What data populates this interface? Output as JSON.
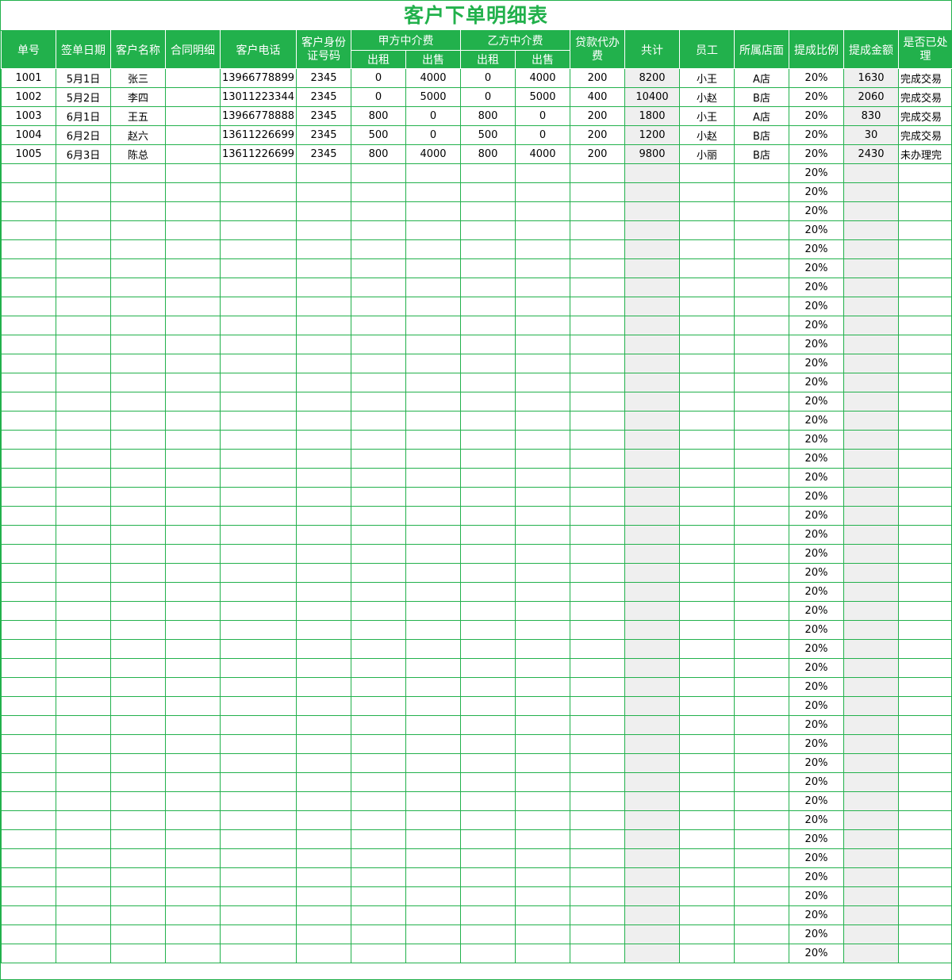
{
  "title": "客户下单明细表",
  "headers": {
    "order_no": "单号",
    "sign_date": "签单日期",
    "customer_name": "客户名称",
    "contract_detail": "合同明细",
    "customer_phone": "客户电话",
    "customer_id": "客户身份证号码",
    "party_a_fee": "甲方中介费",
    "party_b_fee": "乙方中介费",
    "rent": "出租",
    "sale": "出售",
    "loan_fee": "贷款代办费",
    "total": "共计",
    "employee": "员工",
    "store": "所属店面",
    "commission_rate": "提成比例",
    "commission_amount": "提成金额",
    "processed": "是否已处理"
  },
  "rows": [
    {
      "no": "1001",
      "date": "5月1日",
      "name": "张三",
      "contract": "",
      "phone": "13966778899",
      "id": "2345",
      "a_rent": "0",
      "a_sale": "4000",
      "b_rent": "0",
      "b_sale": "4000",
      "loan": "200",
      "total": "8200",
      "employee": "小王",
      "store": "A店",
      "rate": "20%",
      "amount": "1630",
      "status": "完成交易"
    },
    {
      "no": "1002",
      "date": "5月2日",
      "name": "李四",
      "contract": "",
      "phone": "13011223344",
      "id": "2345",
      "a_rent": "0",
      "a_sale": "5000",
      "b_rent": "0",
      "b_sale": "5000",
      "loan": "400",
      "total": "10400",
      "employee": "小赵",
      "store": "B店",
      "rate": "20%",
      "amount": "2060",
      "status": "完成交易"
    },
    {
      "no": "1003",
      "date": "6月1日",
      "name": "王五",
      "contract": "",
      "phone": "13966778888",
      "id": "2345",
      "a_rent": "800",
      "a_sale": "0",
      "b_rent": "800",
      "b_sale": "0",
      "loan": "200",
      "total": "1800",
      "employee": "小王",
      "store": "A店",
      "rate": "20%",
      "amount": "830",
      "status": "完成交易"
    },
    {
      "no": "1004",
      "date": "6月2日",
      "name": "赵六",
      "contract": "",
      "phone": "13611226699",
      "id": "2345",
      "a_rent": "500",
      "a_sale": "0",
      "b_rent": "500",
      "b_sale": "0",
      "loan": "200",
      "total": "1200",
      "employee": "小赵",
      "store": "B店",
      "rate": "20%",
      "amount": "30",
      "status": "完成交易"
    },
    {
      "no": "1005",
      "date": "6月3日",
      "name": "陈总",
      "contract": "",
      "phone": "13611226699",
      "id": "2345",
      "a_rent": "800",
      "a_sale": "4000",
      "b_rent": "800",
      "b_sale": "4000",
      "loan": "200",
      "total": "9800",
      "employee": "小丽",
      "store": "B店",
      "rate": "20%",
      "amount": "2430",
      "status": "未办理完"
    }
  ],
  "empty_row_rate": "20%",
  "empty_row_count": 42,
  "colors": {
    "accent": "#22b14c",
    "computed_cell_bg": "#efefef"
  }
}
